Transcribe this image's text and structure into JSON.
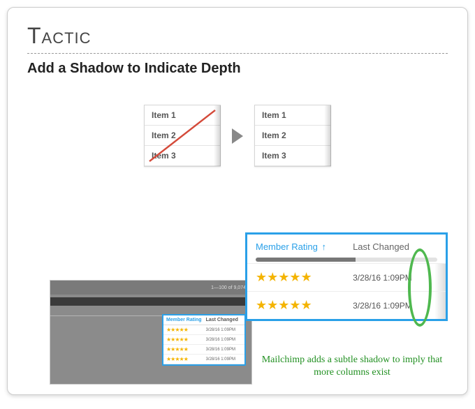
{
  "header": {
    "label": "Tactic",
    "title": "Add a Shadow to Indicate Depth"
  },
  "compare": {
    "items": [
      "Item 1",
      "Item 2",
      "Item 3"
    ]
  },
  "example": {
    "pager": "1—100 of 9,074",
    "columns": {
      "rating": "Member Rating",
      "changed": "Last Changed"
    },
    "sort_icon": "↑",
    "rows": [
      {
        "stars": "★★★★★",
        "ts": "3/28/16 1:09PM"
      },
      {
        "stars": "★★★★★",
        "ts": "3/28/16 1:09PM"
      }
    ],
    "caption": "Mailchimp adds a subtle shadow to imply that more columns exist"
  }
}
